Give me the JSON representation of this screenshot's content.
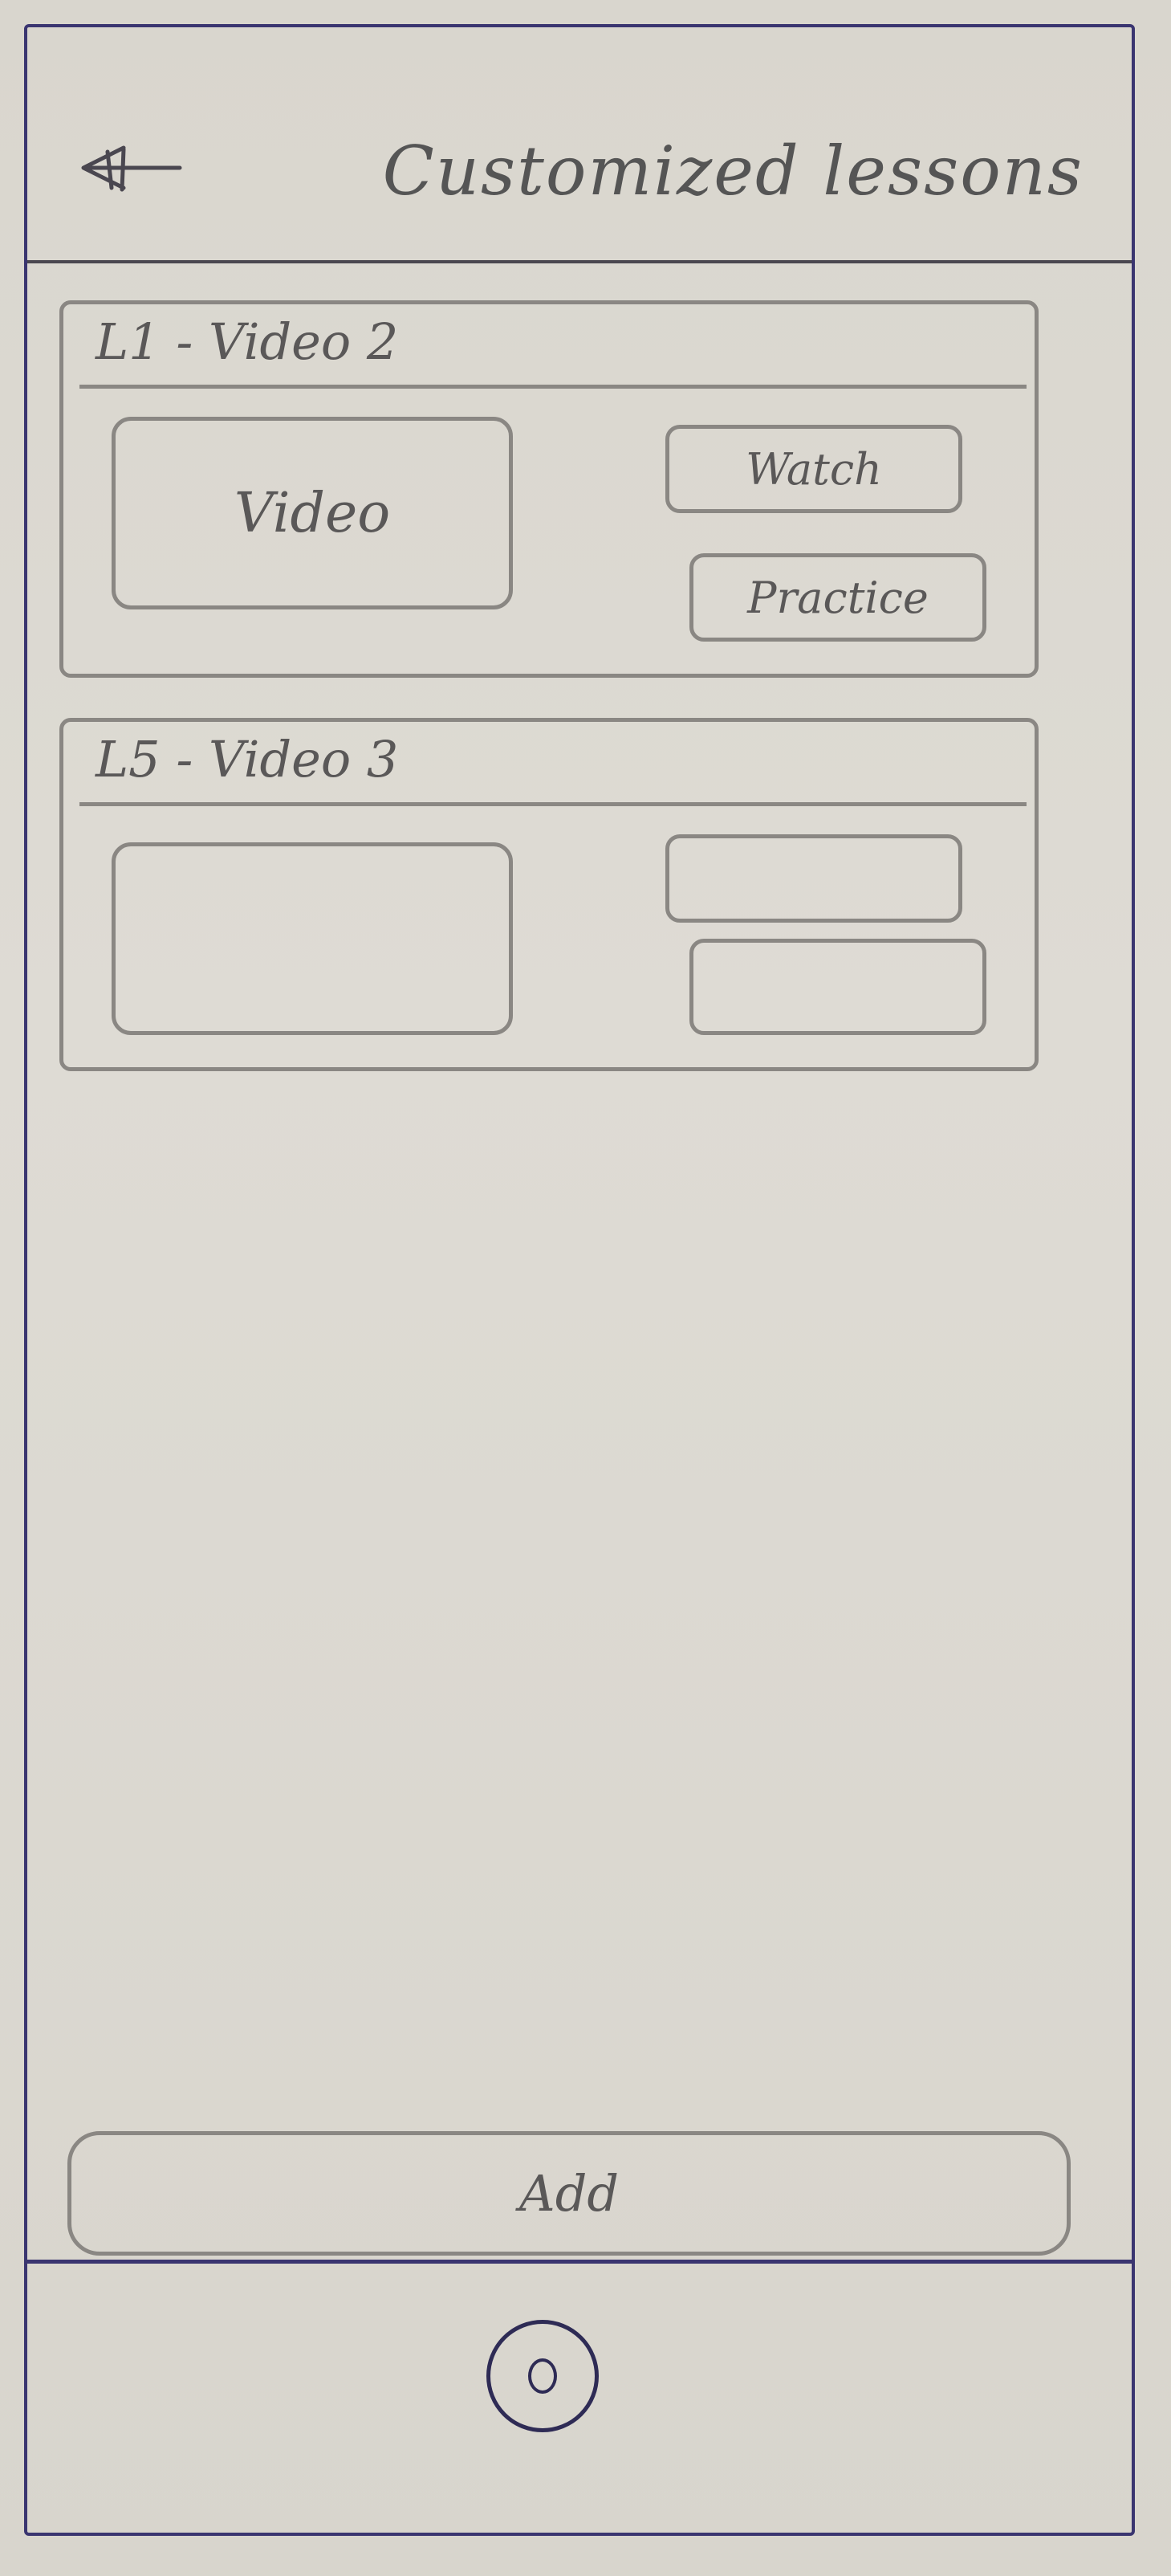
{
  "header": {
    "title": "Customized lessons",
    "back_icon": "back-arrow-icon"
  },
  "lessons": [
    {
      "title": "L1 - Video 2",
      "video_label": "Video",
      "watch_label": "Watch",
      "practice_label": "Practice"
    },
    {
      "title": "L5 - Video 3",
      "video_label": "",
      "watch_label": "",
      "practice_label": ""
    }
  ],
  "footer": {
    "add_label": "Add",
    "home_icon": "home-button-icon"
  },
  "colors": {
    "frame": "#3a3570",
    "pencil": "#8a8783",
    "paper": "#dcd9d2"
  }
}
